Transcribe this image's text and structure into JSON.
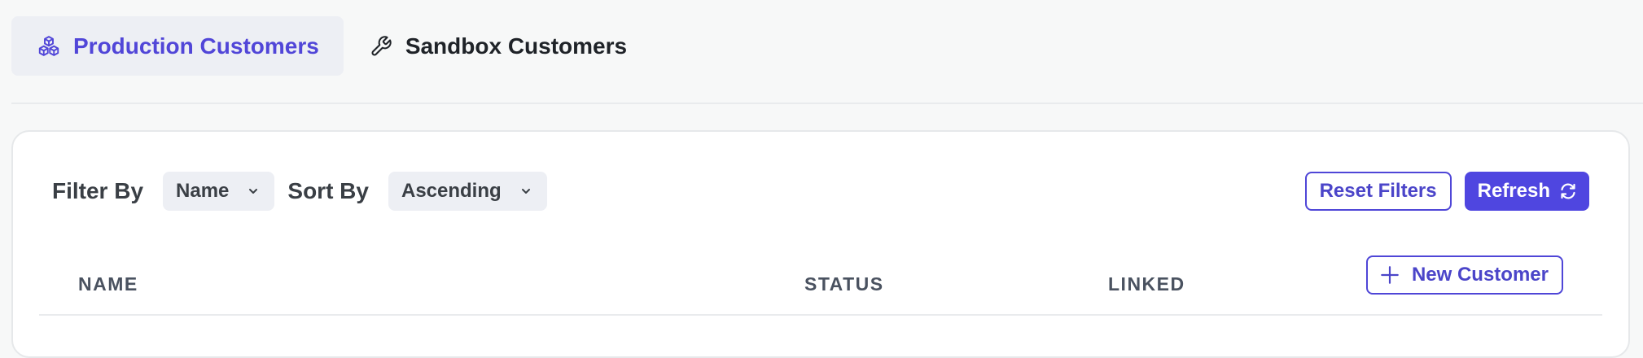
{
  "tabs": [
    {
      "label": "Production Customers",
      "icon": "cubes-icon",
      "active": true
    },
    {
      "label": "Sandbox Customers",
      "icon": "wrench-icon",
      "active": false
    }
  ],
  "toolbar": {
    "filter_label": "Filter By",
    "filter_value": "Name",
    "sort_label": "Sort By",
    "sort_value": "Ascending",
    "reset_label": "Reset Filters",
    "refresh_label": "Refresh"
  },
  "table": {
    "columns": [
      "NAME",
      "STATUS",
      "LINKED"
    ],
    "new_customer_label": "New Customer"
  },
  "colors": {
    "accent": "#4f46e0",
    "active_tab_bg": "#edeff4",
    "page_bg": "#f7f8f8"
  }
}
